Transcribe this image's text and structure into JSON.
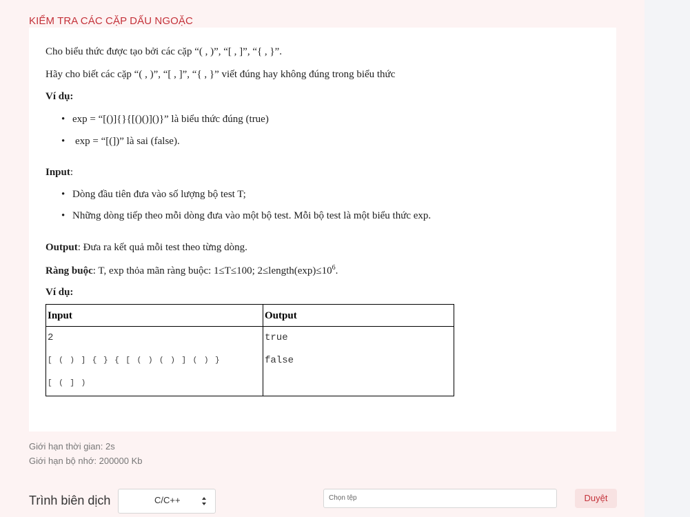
{
  "problem": {
    "title": "KIỂM TRA CÁC CẶP DẤU NGOẶC",
    "intro1": "Cho biểu thức được tạo bởi các cặp “( , )”, “[ , ]”, “{ , }”.",
    "intro2": "Hãy cho biết các cặp “( , )”, “[ , ]”, “{ , }” viết đúng hay không đúng trong biểu thức",
    "example_heading": "Ví dụ:",
    "examples": [
      "exp = “[()]{}{[()()]()}” là biểu thức đúng (true)",
      "exp = “[(])” là sai (false)."
    ],
    "input_heading": "Input",
    "input_colon": ":",
    "input_items": [
      "Dòng đầu tiên đưa vào số lượng bộ test T;",
      "Những dòng tiếp theo mỗi dòng đưa vào một bộ test. Mỗi bộ test là một biểu thức exp."
    ],
    "output_heading": "Output",
    "output_text": ":  Đưa ra kết quả mỗi test theo từng dòng.",
    "constraint_heading": "Ràng buộc",
    "constraint_text": ": T, exp thỏa mãn ràng buộc: 1≤T≤100; 2≤length(exp)≤10",
    "constraint_exp": "6",
    "constraint_end": ".",
    "example2_heading": "Ví dụ:",
    "table": {
      "headers": [
        "Input",
        "Output"
      ],
      "input_lines": [
        "2",
        "[ ( ) ] { } { [ ( ) ( ) ] ( ) }",
        "[ ( ] )"
      ],
      "output_lines": [
        "true",
        "false"
      ]
    }
  },
  "limits": {
    "time": "Giới hạn thời gian: 2s",
    "memory": "Giới hạn bộ nhớ: 200000 Kb"
  },
  "submit": {
    "compiler_label": "Trình biên dịch",
    "compiler_value": "C/C++",
    "file_placeholder": "Chọn tệp",
    "browse_label": "Duyệt"
  }
}
